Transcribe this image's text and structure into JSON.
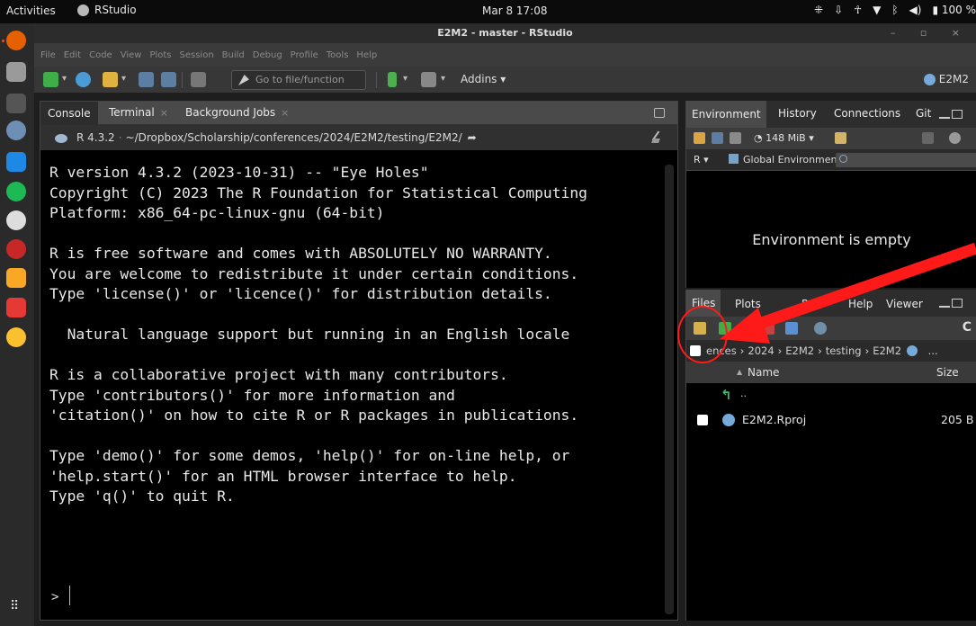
{
  "os": {
    "activities": "Activities",
    "app_name": "RStudio",
    "clock": "Mar 8  17:08",
    "battery": "100 %"
  },
  "window": {
    "title": "E2M2 - master - RStudio"
  },
  "menu": [
    "File",
    "Edit",
    "Code",
    "View",
    "Plots",
    "Session",
    "Build",
    "Debug",
    "Profile",
    "Tools",
    "Help"
  ],
  "toolbar": {
    "goto_placeholder": "Go to file/function",
    "addins": "Addins",
    "project": "E2M2"
  },
  "console": {
    "tabs": [
      "Console",
      "Terminal",
      "Background Jobs"
    ],
    "r_version": "R 4.3.2",
    "path": "~/Dropbox/Scholarship/conferences/2024/E2M2/testing/E2M2/",
    "output": "R version 4.3.2 (2023-10-31) -- \"Eye Holes\"\nCopyright (C) 2023 The R Foundation for Statistical Computing\nPlatform: x86_64-pc-linux-gnu (64-bit)\n\nR is free software and comes with ABSOLUTELY NO WARRANTY.\nYou are welcome to redistribute it under certain conditions.\nType 'license()' or 'licence()' for distribution details.\n\n  Natural language support but running in an English locale\n\nR is a collaborative project with many contributors.\nType 'contributors()' for more information and\n'citation()' on how to cite R or R packages in publications.\n\nType 'demo()' for some demos, 'help()' for on-line help, or\n'help.start()' for an HTML browser interface to help.\nType 'q()' to quit R.",
    "prompt": ">"
  },
  "environment": {
    "tabs": [
      "Environment",
      "History",
      "Connections",
      "Git"
    ],
    "memory": "148 MiB",
    "language": "R",
    "scope": "Global Environment",
    "empty_message": "Environment is empty"
  },
  "files": {
    "tabs": [
      "Files",
      "Plots",
      "P",
      "Help",
      "Viewer"
    ],
    "breadcrumb": [
      "ences",
      "2024",
      "E2M2",
      "testing",
      "E2M2"
    ],
    "breadcrumb_more": "...",
    "columns": {
      "name": "Name",
      "size": "Size"
    },
    "parent_label": "..",
    "rows": [
      {
        "name": "E2M2.Rproj",
        "size": "205 B"
      }
    ]
  },
  "colors": {
    "annotation_red": "#ff1a1a",
    "r_blue": "#75aadb"
  },
  "icons": {
    "new_folder": "new-folder-icon",
    "upload": "upload-icon",
    "refresh": "refresh-icon"
  }
}
